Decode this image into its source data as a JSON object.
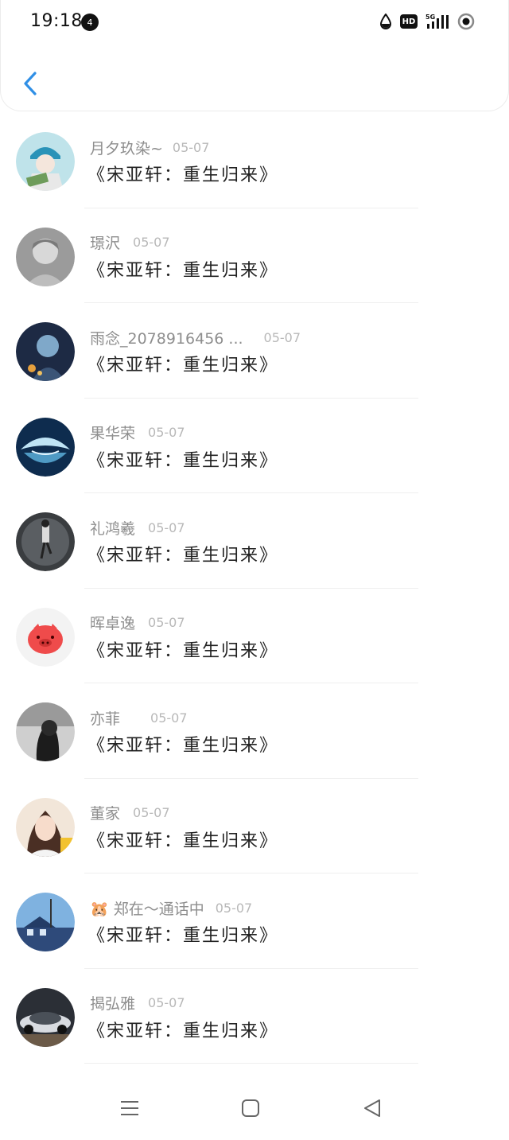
{
  "status_bar": {
    "time": "19:18",
    "notif_badge": "4",
    "hd_label": "HD",
    "network": "5G"
  },
  "items": [
    {
      "name": "月夕玖染~",
      "date": "05-07",
      "title": "《宋亚轩：重生归来》",
      "name_gap": 12
    },
    {
      "name": "璟沢",
      "date": "05-07",
      "title": "《宋亚轩：重生归来》",
      "name_gap": 16
    },
    {
      "name": "雨念_2078916456 ...",
      "date": "05-07",
      "title": "《宋亚轩：重生归来》",
      "name_gap": 26
    },
    {
      "name": "果华荣",
      "date": "05-07",
      "title": "《宋亚轩：重生归来》",
      "name_gap": 16
    },
    {
      "name": "礼鸿羲",
      "date": "05-07",
      "title": "《宋亚轩：重生归来》",
      "name_gap": 16
    },
    {
      "name": "晖卓逸",
      "date": "05-07",
      "title": "《宋亚轩：重生归来》",
      "name_gap": 16
    },
    {
      "name": "亦菲",
      "date": "05-07",
      "title": "《宋亚轩：重生归来》",
      "name_gap": 38
    },
    {
      "name": "董家",
      "date": "05-07",
      "title": "《宋亚轩：重生归来》",
      "name_gap": 16
    },
    {
      "name": "🐹 郑在～通话中",
      "date": "05-07",
      "title": "《宋亚轩：重生归来》",
      "name_gap": 14
    },
    {
      "name": "揭弘雅",
      "date": "05-07",
      "title": "《宋亚轩：重生归来》",
      "name_gap": 16
    }
  ],
  "colors": {
    "accent": "#2f8fe6",
    "name": "#8e8e8e",
    "date": "#b8b8b8",
    "title": "#222222"
  }
}
